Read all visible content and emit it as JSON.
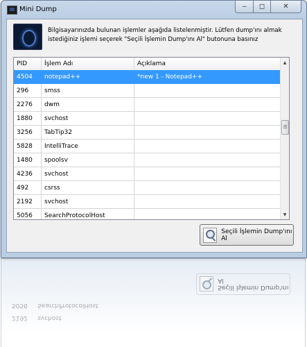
{
  "window": {
    "title": "Mini Dump",
    "controls": {
      "minimize": "‒",
      "maximize": "◻",
      "close": "✕"
    }
  },
  "header": {
    "icon": "dump-app-icon",
    "description": "Bilgisayarınızda bulunan işlemler aşağıda listelenmiştir. Lütfen dump'ını almak istediğiniz işlemi seçerek \"Seçili İşlemin Dump'ını Al\" butonuna basınız"
  },
  "grid": {
    "columns": {
      "pid": "PID",
      "name": "İşlem Adı",
      "desc": "Açıklama"
    },
    "rows": [
      {
        "pid": "4504",
        "name": "notepad++",
        "desc": "*new  1 - Notepad++",
        "selected": true
      },
      {
        "pid": "296",
        "name": "smss",
        "desc": ""
      },
      {
        "pid": "2276",
        "name": "dwm",
        "desc": ""
      },
      {
        "pid": "1880",
        "name": "svchost",
        "desc": ""
      },
      {
        "pid": "3256",
        "name": "TabTip32",
        "desc": ""
      },
      {
        "pid": "5828",
        "name": "IntelliTrace",
        "desc": ""
      },
      {
        "pid": "1480",
        "name": "spoolsv",
        "desc": ""
      },
      {
        "pid": "4236",
        "name": "svchost",
        "desc": ""
      },
      {
        "pid": "492",
        "name": "csrss",
        "desc": ""
      },
      {
        "pid": "2192",
        "name": "svchost",
        "desc": ""
      },
      {
        "pid": "5056",
        "name": "SearchProtocolHost",
        "desc": ""
      }
    ]
  },
  "dump_button": {
    "label": "Seçili İşlemin Dump'ını Al",
    "icon": "magnifier-icon"
  },
  "colors": {
    "selection": "#3399ff",
    "window_frame": "#b9cde3",
    "client": "#f0f0f0"
  }
}
